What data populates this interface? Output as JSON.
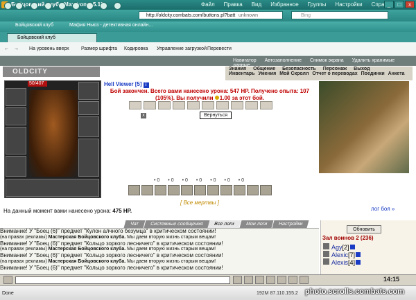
{
  "window": {
    "title": "Бойцовский клуб - Maxthon 2.5.15",
    "menu": [
      "Файл",
      "Правка",
      "Вид",
      "Избранное",
      "Группы",
      "Настройки",
      "Справка"
    ],
    "controls": [
      "_",
      "□",
      "x"
    ]
  },
  "address": {
    "url": "http://oldcity.combats.com/buttons.pl?batt",
    "security": "unknown"
  },
  "search": {
    "placeholder": "Bing"
  },
  "favorites": [
    "Бойцовский клуб",
    "Мафия Ньюз - детективная онлайн..."
  ],
  "tabs": [
    {
      "label": "Бойцовский клуб",
      "active": true
    }
  ],
  "toolbar": {
    "items": [
      "На уровень вверх",
      "Размер шрифта",
      "Кодировка",
      "Управление загрузкой",
      "Перевести"
    ],
    "right": [
      "Навигатор",
      "Автозаполнение",
      "Снимок экрана",
      "Удалить хранимые данные..."
    ]
  },
  "game": {
    "logo": "OLDCITY",
    "menu_top": [
      "Знания",
      "Общение",
      "Безопасность",
      "Персонаж",
      "Выход"
    ],
    "menu_bottom": [
      "Инвентарь",
      "Умения",
      "Мой Скролл",
      "Отчет о переводах",
      "Поединки",
      "Анкета"
    ],
    "hp": "50/407",
    "char_name": "Hell Viewer [5]",
    "result_line1": "Бой закончен. Всего вами нанесено урона: 547 HP. Получено опыта: 107",
    "result_line2": "(105%). Вы получили ",
    "result_line2_coins": "1.00",
    "result_line2_end": " за этот бой.",
    "back_button": "Вернуться",
    "stats": [
      "0",
      "0",
      "0",
      "0",
      "0",
      "0",
      "0"
    ],
    "dead_link": "[ Все мертвы ]",
    "damage_label": "На данный момент вами нанесено урона: ",
    "damage_value": "475 HP.",
    "battle_log": "лог боя »"
  },
  "chat": {
    "tabs": [
      "Чат",
      "Системные сообщения",
      "Все логи",
      "Мои логи",
      "Настройки"
    ],
    "active_tab": "Все логи",
    "messages": [
      "Внимание! У \"Боец (6)\" предмет \"Кулон алчного безумца\" в критическом состоянии!",
      "(на правах рекламы) |Мастерская Бойцовского клуба.| Мы даем вторую жизнь старым вещам!",
      "Внимание! У \"Боец (6)\" предмет \"Кольцо зоркого лесничего\" в критическом состоянии!",
      "(на правах рекламы) |Мастерская Бойцовского клуба.| Мы даем вторую жизнь старым вещам!",
      "Внимание! У \"Боец (6)\" предмет \"Кольцо зоркого лесничего\" в критическом состоянии!",
      "(на правах рекламы) |Мастерская Бойцовского клуба.| Мы даем вторую жизнь старым вещам!",
      "Внимание! У \"Боец (6)\" предмет \"Кольцо зоркого лесничего\" в критическом состоянии!"
    ]
  },
  "room": {
    "refresh": "Обновить",
    "title": "Зал воинов 2 (236)",
    "players": [
      {
        "name": "Agy",
        "level": "[2]"
      },
      {
        "name": "Alexic",
        "level": "[7]"
      },
      {
        "name": "Alexis",
        "level": "[4]"
      }
    ]
  },
  "bottom": {
    "clock": "14:15",
    "done": "Done",
    "ip": "192M 87.110.155.2",
    "watermark": "photo.scrolls.combats.com"
  }
}
